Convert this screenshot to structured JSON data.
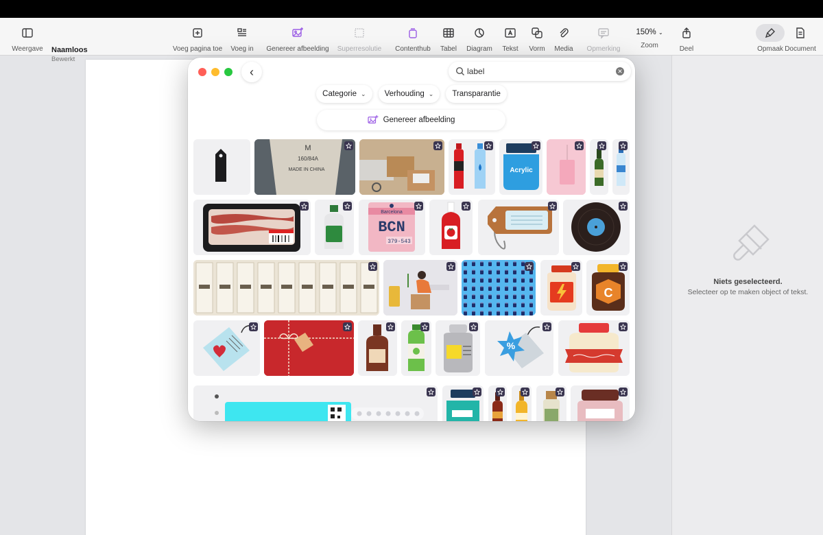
{
  "document": {
    "title": "Naamloos",
    "subtitle": "Bewerkt"
  },
  "toolbar": {
    "view": "Weergave",
    "add_page": "Voeg pagina toe",
    "insert": "Voeg in",
    "generate_image": "Genereer afbeelding",
    "superresolution": "Superresolutie",
    "content_hub": "Contenthub",
    "table": "Tabel",
    "chart": "Diagram",
    "text": "Tekst",
    "shape": "Vorm",
    "media": "Media",
    "comment": "Opmerking",
    "zoom_value": "150%",
    "zoom": "Zoom",
    "share": "Deel",
    "format": "Opmaak",
    "document": "Document"
  },
  "popup": {
    "search_value": "label",
    "filters": [
      "Categorie",
      "Verhouding",
      "Transparantie"
    ],
    "generate_label": "Genereer afbeelding",
    "barcelona": "Barcelona",
    "bcn": "BCN",
    "bcn_code": "379-543",
    "acrylic": "Acrylic",
    "garment_size": "M",
    "garment_spec": "160/84A",
    "garment_origin": "MADE IN CHINA",
    "jar_letter": "C"
  },
  "sidebar": {
    "title": "Niets geselecteerd.",
    "subtitle": "Selecteer op te maken object of tekst."
  },
  "colors": {
    "accent_purple": "#9b5de5",
    "badge_bg": "#3a3550"
  }
}
